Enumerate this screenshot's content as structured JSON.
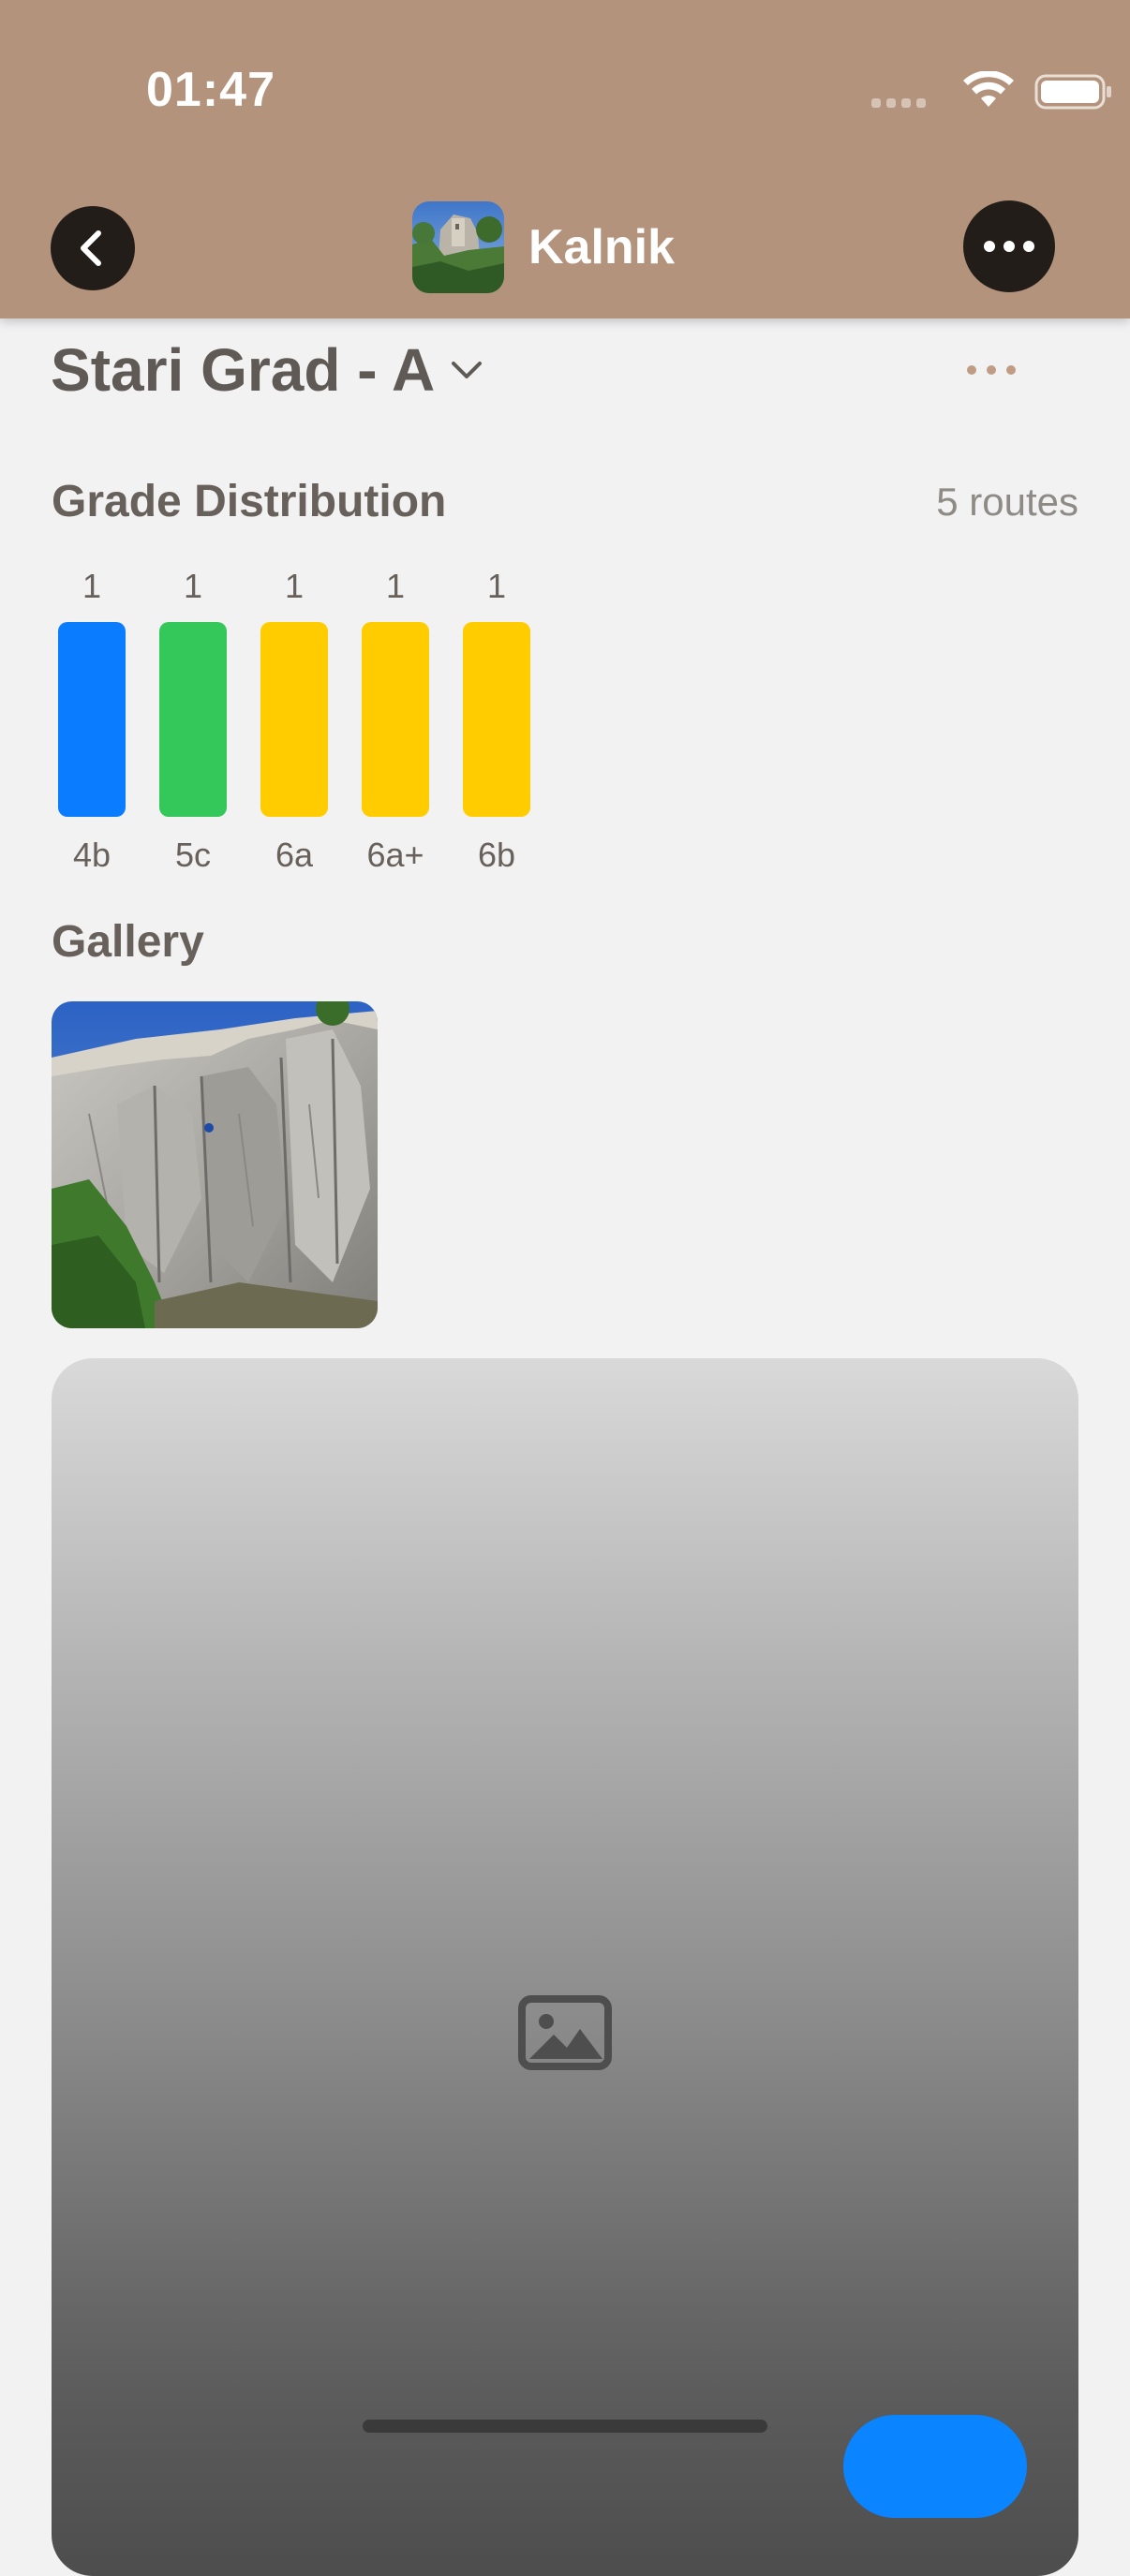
{
  "status_bar": {
    "time": "01:47"
  },
  "header": {
    "crag_name": "Kalnik",
    "back_icon": "chevron-left-icon",
    "more_icon": "ellipsis-icon"
  },
  "sector": {
    "title": "Stari Grad - A"
  },
  "grade_distribution": {
    "title": "Grade Distribution",
    "routes_count": "5 routes",
    "bars": [
      {
        "count": "1",
        "grade": "4b",
        "color": "#0a7cff",
        "level": 1
      },
      {
        "count": "1",
        "grade": "5c",
        "color": "#34c759",
        "level": 1
      },
      {
        "count": "1",
        "grade": "6a",
        "color": "#ffcc00",
        "level": 1
      },
      {
        "count": "1",
        "grade": "6a+",
        "color": "#ffcc00",
        "level": 1
      },
      {
        "count": "1",
        "grade": "6b",
        "color": "#ffcc00",
        "level": 1
      }
    ]
  },
  "gallery": {
    "title": "Gallery"
  },
  "topo_card": {
    "title": "",
    "placeholder_icon": "image-placeholder-icon",
    "action_label": ""
  },
  "colors": {
    "header_bg": "#b3937b",
    "page_bg": "#f2f2f2",
    "dark_button": "#231d19",
    "accent_blue": "#0a84ff"
  }
}
